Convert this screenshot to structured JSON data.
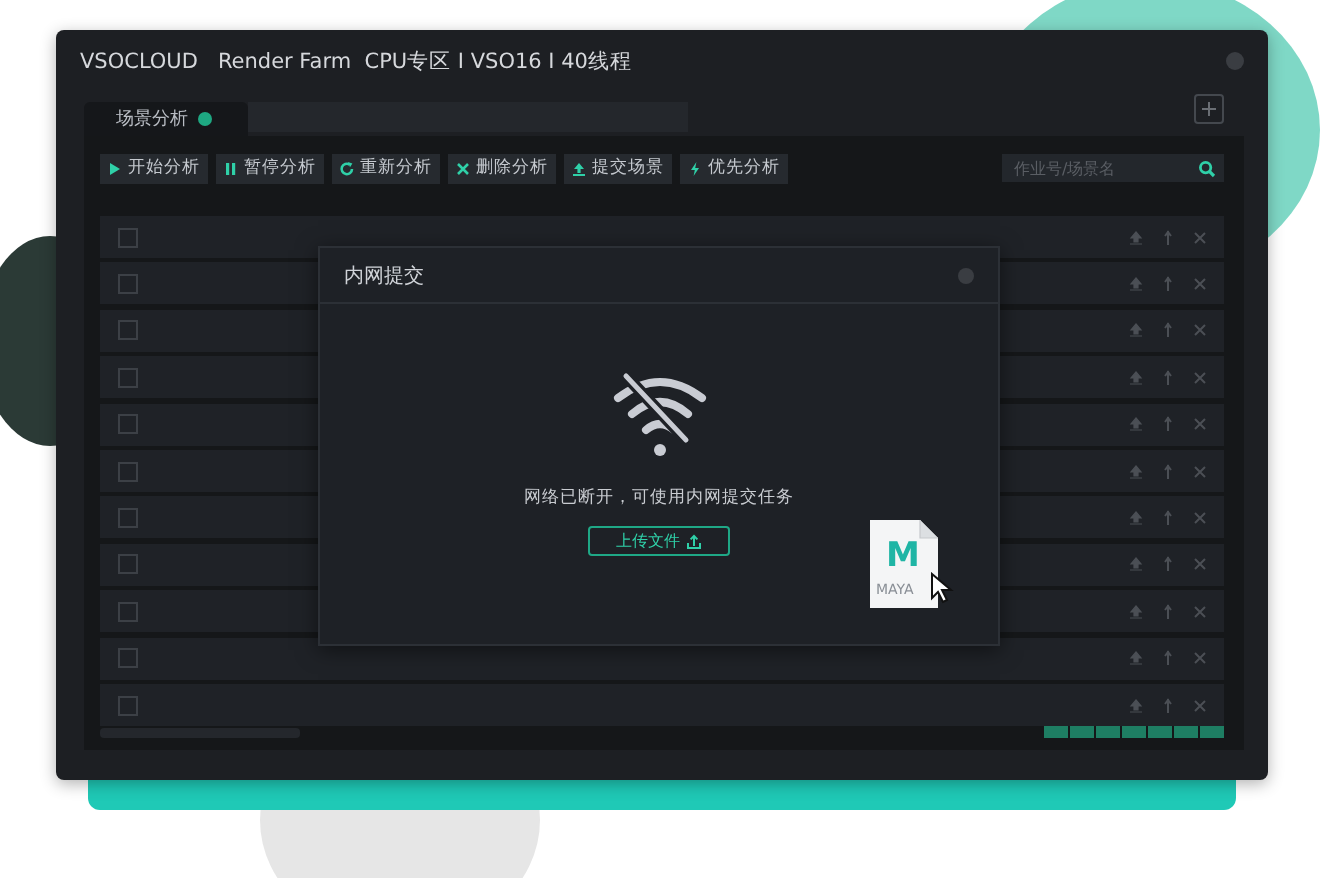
{
  "window": {
    "title": "VSOCLOUD   Render Farm  CPU专区 I VSO16 I 40线程"
  },
  "tabs": [
    {
      "label": "场景分析",
      "selected": true
    }
  ],
  "toolbar": [
    {
      "label": "开始分析",
      "kind": "play"
    },
    {
      "label": "暂停分析",
      "kind": "pause"
    },
    {
      "label": "重新分析",
      "kind": "refresh"
    },
    {
      "label": "删除分析",
      "kind": "delete"
    },
    {
      "label": "提交场景",
      "kind": "upload"
    },
    {
      "label": "优先分析",
      "kind": "bolt"
    }
  ],
  "search": {
    "placeholder": "作业号/场景名"
  },
  "rows": [
    {
      "checked": false
    },
    {
      "checked": false
    },
    {
      "checked": false
    },
    {
      "checked": false
    },
    {
      "checked": false
    },
    {
      "checked": false
    },
    {
      "checked": false
    },
    {
      "checked": false
    },
    {
      "checked": false
    },
    {
      "checked": false
    },
    {
      "checked": false
    }
  ],
  "dialog": {
    "title": "内网提交",
    "message": "网络已断开，可使用内网提交任务",
    "button": "上传文件",
    "file": {
      "letter": "M",
      "label": "MAYA"
    }
  }
}
